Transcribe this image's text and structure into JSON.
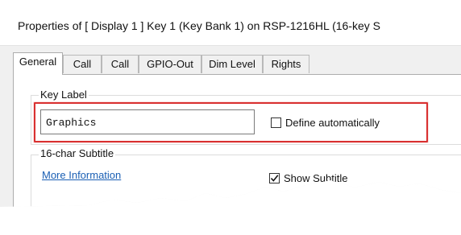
{
  "window": {
    "title": "Properties of [ Display 1 ] Key 1 (Key Bank 1) on RSP-1216HL (16-key S"
  },
  "tabs": [
    {
      "label": "General",
      "active": true
    },
    {
      "label": "Call",
      "active": false
    },
    {
      "label": "Call",
      "active": false
    },
    {
      "label": "GPIO-Out",
      "active": false
    },
    {
      "label": "Dim Level",
      "active": false
    },
    {
      "label": "Rights",
      "active": false
    }
  ],
  "key_label": {
    "group_title": "Key Label",
    "value": "Graphics",
    "define_auto_label": "Define automatically",
    "define_auto_checked": false
  },
  "subtitle": {
    "group_title": "16-char Subtitle",
    "more_info_link": "More Information",
    "show_subtitle_label": "Show Subtitle",
    "show_subtitle_checked": true
  },
  "colors": {
    "highlight": "#d93030",
    "link": "#1a5fb4"
  }
}
